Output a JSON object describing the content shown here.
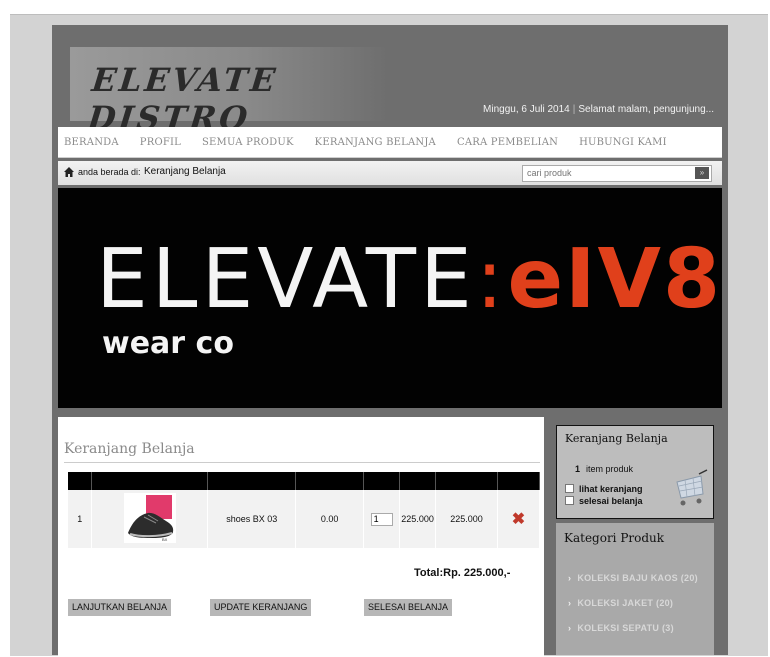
{
  "site": {
    "logo": "ELEVATE DISTRO",
    "date": "Minggu, 6 Juli 2014",
    "greeting": "Selamat malam, pengunjung..."
  },
  "nav": [
    "BERANDA",
    "PROFIL",
    "SEMUA PRODUK",
    "KERANJANG BELANJA",
    "CARA PEMBELIAN",
    "HUBUNGI KAMI"
  ],
  "breadcrumb": {
    "prefix": "anda berada di:",
    "current": "Keranjang Belanja"
  },
  "search": {
    "placeholder": "cari produk",
    "button": "»"
  },
  "banner": {
    "word": "ELEVATE",
    "colon": ":",
    "mark": "eIV8",
    "sub": "wear co"
  },
  "cart": {
    "title": "Keranjang Belanja",
    "rows": [
      {
        "no": "1",
        "name": "shoes BX 03",
        "discount": "0.00",
        "qty": "1",
        "price": "225.000",
        "subtotal": "225.000"
      }
    ],
    "total_label": "Total:",
    "total_value": "Rp. 225.000,-",
    "buttons": {
      "continue": "LANJUTKAN BELANJA",
      "update": "UPDATE KERANJANG",
      "finish": "SELESAI BELANJA"
    }
  },
  "sidebar": {
    "cart_box": {
      "title": "Keranjang Belanja",
      "count": "1",
      "count_label": "item produk",
      "view": "lihat keranjang",
      "finish": "selesai belanja"
    },
    "categories": {
      "title": "Kategori Produk",
      "items": [
        "KOLEKSI BAJU KAOS (20)",
        "KOLEKSI JAKET (20)",
        "KOLEKSI SEPATU (3)"
      ]
    }
  }
}
